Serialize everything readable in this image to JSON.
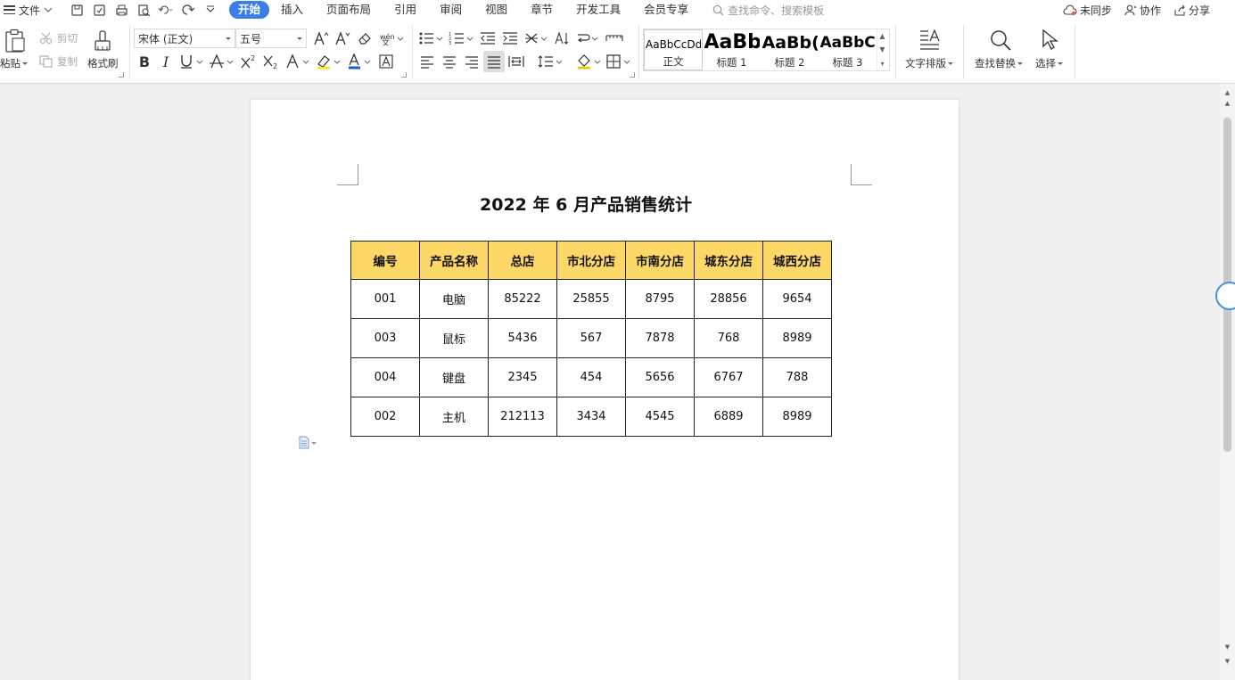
{
  "menubar": {
    "file_label": "文件",
    "tabs": [
      {
        "label": "开始",
        "active": true
      },
      {
        "label": "插入"
      },
      {
        "label": "页面布局"
      },
      {
        "label": "引用"
      },
      {
        "label": "审阅"
      },
      {
        "label": "视图"
      },
      {
        "label": "章节"
      },
      {
        "label": "开发工具"
      },
      {
        "label": "会员专享"
      }
    ],
    "search_placeholder": "查找命令、搜索模板",
    "right": {
      "sync": "未同步",
      "collab": "协作",
      "share": "分享"
    }
  },
  "ribbon": {
    "paste": "粘贴",
    "cut": "剪切",
    "copy": "复制",
    "format_painter": "格式刷",
    "font_name": "宋体 (正文)",
    "font_size": "五号",
    "styles": [
      {
        "preview": "AaBbCcDd",
        "label": "正文"
      },
      {
        "preview": "AaBb",
        "label": "标题 1"
      },
      {
        "preview": "AaBb(",
        "label": "标题 2"
      },
      {
        "preview": "AaBbC(",
        "label": "标题 3"
      }
    ],
    "text_layout": "文字排版",
    "find_replace": "查找替换",
    "select": "选择"
  },
  "document": {
    "title": "2022 年 6 月产品销售统计",
    "table": {
      "headers": [
        "编号",
        "产品名称",
        "总店",
        "市北分店",
        "市南分店",
        "城东分店",
        "城西分店"
      ],
      "rows": [
        [
          "001",
          "电脑",
          "85222",
          "25855",
          "8795",
          "28856",
          "9654"
        ],
        [
          "003",
          "鼠标",
          "5436",
          "567",
          "7878",
          "768",
          "8989"
        ],
        [
          "004",
          "键盘",
          "2345",
          "454",
          "5656",
          "6767",
          "788"
        ],
        [
          "002",
          "主机",
          "212113",
          "3434",
          "4545",
          "6889",
          "8989"
        ]
      ]
    }
  },
  "colors": {
    "accent": "#3a7ee8",
    "table_header_bg": "#fdd866"
  }
}
